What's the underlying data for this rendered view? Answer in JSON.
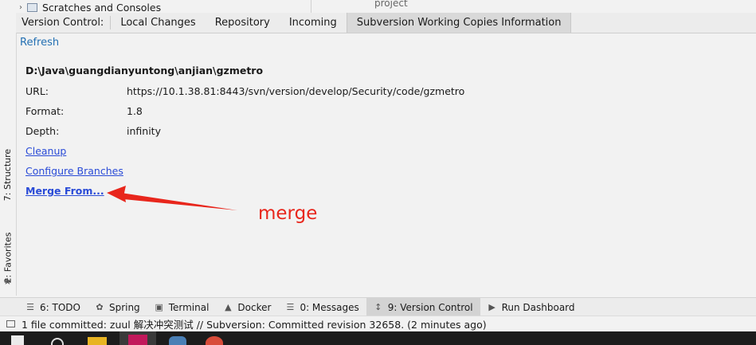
{
  "top": {
    "tree_item": "Scratches and Consoles",
    "project_label": "project"
  },
  "tabs": {
    "label": "Version Control:",
    "items": [
      "Local Changes",
      "Repository",
      "Incoming",
      "Subversion Working Copies Information"
    ],
    "active": "Subversion Working Copies Information"
  },
  "side_tabs": {
    "structure": "7: Structure",
    "favorites": "2: Favorites"
  },
  "content": {
    "refresh": "Refresh",
    "path": "D:\\Java\\guangdianyuntong\\anjian\\gzmetro",
    "url_label": "URL:",
    "url_value": "https://10.1.38.81:8443/svn/version/develop/Security/code/gzmetro",
    "format_label": "Format:",
    "format_value": "1.8",
    "depth_label": "Depth:",
    "depth_value": "infinity",
    "cleanup": "Cleanup",
    "configure_branches": "Configure Branches",
    "merge_from": "Merge From..."
  },
  "annotation": {
    "text": "merge",
    "color": "#e8261c"
  },
  "bottom_tools": [
    {
      "label": "6: TODO",
      "icon": "list-icon"
    },
    {
      "label": "Spring",
      "icon": "spring-leaf-icon"
    },
    {
      "label": "Terminal",
      "icon": "terminal-icon"
    },
    {
      "label": "Docker",
      "icon": "docker-icon"
    },
    {
      "label": "0: Messages",
      "icon": "messages-icon"
    },
    {
      "label": "9: Version Control",
      "icon": "version-control-icon",
      "active": true
    },
    {
      "label": "Run Dashboard",
      "icon": "run-icon"
    }
  ],
  "status": {
    "text": "1 file committed: zuul 解决冲突测试 // Subversion: Committed revision 32658. (2 minutes ago)"
  },
  "colors": {
    "link": "#2a4bd7",
    "refresh": "#2470b3",
    "annotation": "#e8261c"
  }
}
